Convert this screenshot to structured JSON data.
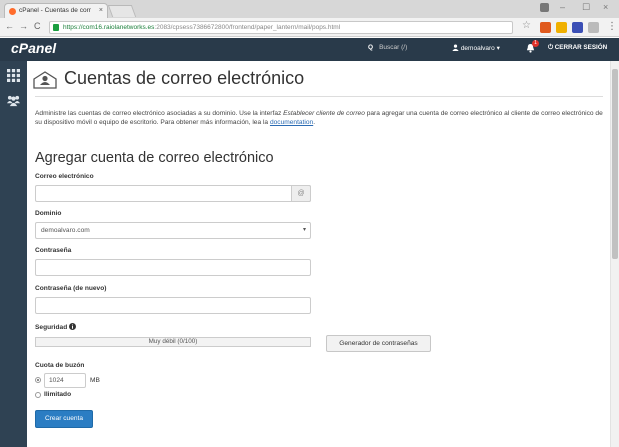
{
  "browser": {
    "tab_title": "cPanel - Cuentas de corr",
    "tab_close": "×",
    "url_host": "https://com16.raiolanetworks.es",
    "url_path": ":2083/cpsess7386672800/frontend/paper_lantern/mail/pops.html",
    "win_min": "–",
    "win_max": "☐",
    "win_close": "×",
    "back": "←",
    "forward": "→",
    "reload": "C",
    "star": "☆",
    "menu": "⋮"
  },
  "header": {
    "logo": "cPanel",
    "search_icon": "Q",
    "search_placeholder": "Buscar (/)",
    "user": "demoalvaro",
    "user_caret": "▾",
    "notifications_count": "1",
    "logout": "CERRAR SESIÓN"
  },
  "page": {
    "title": "Cuentas de correo electrónico",
    "intro_part1": "Administre las cuentas de correo electrónico asociadas a su dominio. Use la interfaz ",
    "intro_em": "Establecer cliente de correo",
    "intro_part2": " para agregar una cuenta de correo electrónico al cliente de correo electrónico de su dispositivo móvil o equipo de escritorio. Para obtener más información, lea la ",
    "intro_link": "documentation",
    "intro_end": "."
  },
  "form": {
    "section_title": "Agregar cuenta de correo electrónico",
    "email_label": "Correo electrónico",
    "email_value": "",
    "email_addon": "@",
    "domain_label": "Dominio",
    "domain_value": "demoalvaro.com",
    "domain_caret": "▾",
    "password_label": "Contraseña",
    "password_value": "",
    "password2_label": "Contraseña (de nuevo)",
    "password2_value": "",
    "security_label": "Seguridad",
    "strength_text": "Muy débil (0/100)",
    "generator_button": "Generador de contraseñas",
    "quota_label": "Cuota de buzón",
    "quota_value": "1024",
    "quota_unit": "MB",
    "unlimited_label": "Ilimitado",
    "create_button": "Crear cuenta"
  },
  "colors": {
    "header_bg": "#293a4a",
    "sidebar_bg": "#2f4253",
    "primary_button": "#2b7dc3",
    "link": "#2b6bb3"
  }
}
